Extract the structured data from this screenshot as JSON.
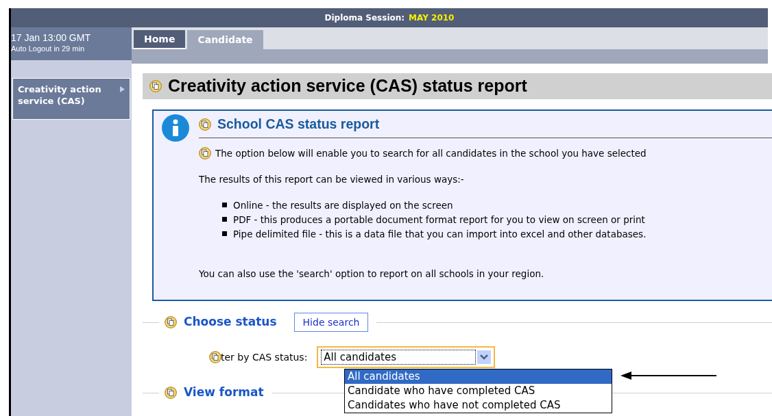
{
  "header": {
    "label": "Diploma Session:",
    "value": "MAY 2010"
  },
  "session_info": {
    "time": "17 Jan 13:00 GMT",
    "logout": "Auto Logout in 29 min"
  },
  "tabs": [
    {
      "label": "Home",
      "selected": false
    },
    {
      "label": "Candidate",
      "selected": true
    }
  ],
  "sidebar": {
    "items": [
      {
        "label": "Creativity action service (CAS)",
        "selected": true
      }
    ]
  },
  "page_title": "Creativity action service (CAS) status report",
  "info_box": {
    "title": "School CAS status report",
    "intro": "The option below will enable you to search for all candidates in the school you have selected",
    "results_heading": "The results of this report can be viewed in various ways:-",
    "bullets": [
      "Online - the results are displayed on the screen",
      "PDF - this produces a portable document format report for you to view on screen or print",
      "Pipe delimited file - this is a data file that you can import into excel and other databases."
    ],
    "footer": "You can also use the 'search' option to report on all schools in your region."
  },
  "sections": [
    {
      "title": "Choose status",
      "button": "Hide search"
    },
    {
      "title": "View format"
    }
  ],
  "filter": {
    "label": "ter by CAS status:",
    "value": "All candidates",
    "expanded": true,
    "options": [
      {
        "label": "All candidates",
        "selected": true
      },
      {
        "label": "Candidate who have completed CAS",
        "selected": false
      },
      {
        "label": "Candidates who have not completed CAS",
        "selected": false
      }
    ]
  }
}
